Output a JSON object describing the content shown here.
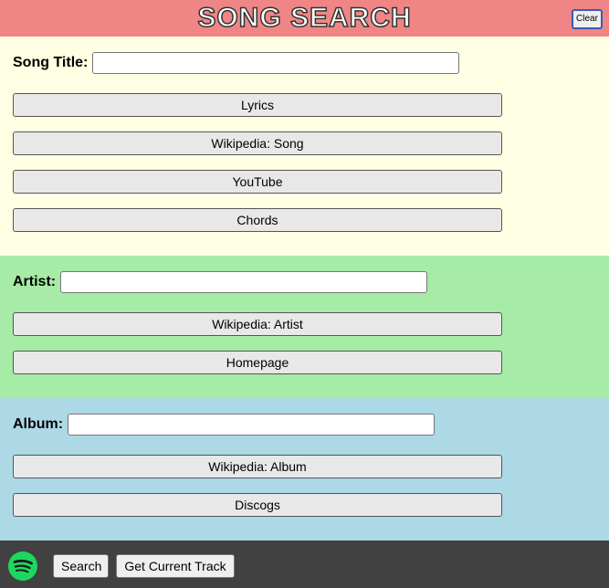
{
  "header": {
    "title": "SONG SEARCH",
    "clear_label": "Clear"
  },
  "song": {
    "label": "Song Title:",
    "value": "",
    "buttons": [
      "Lyrics",
      "Wikipedia: Song",
      "YouTube",
      "Chords"
    ]
  },
  "artist": {
    "label": "Artist:",
    "value": "",
    "buttons": [
      "Wikipedia: Artist",
      "Homepage"
    ]
  },
  "album": {
    "label": "Album:",
    "value": "",
    "buttons": [
      "Wikipedia: Album",
      "Discogs"
    ]
  },
  "footer": {
    "icon": "spotify-icon",
    "search_label": "Search",
    "current_track_label": "Get Current Track"
  },
  "colors": {
    "header": "#f08585",
    "song_section": "#ffffe3",
    "artist_section": "#a6eba6",
    "album_section": "#add8e6",
    "footer": "#414141",
    "spotify_green": "#1ed760"
  }
}
